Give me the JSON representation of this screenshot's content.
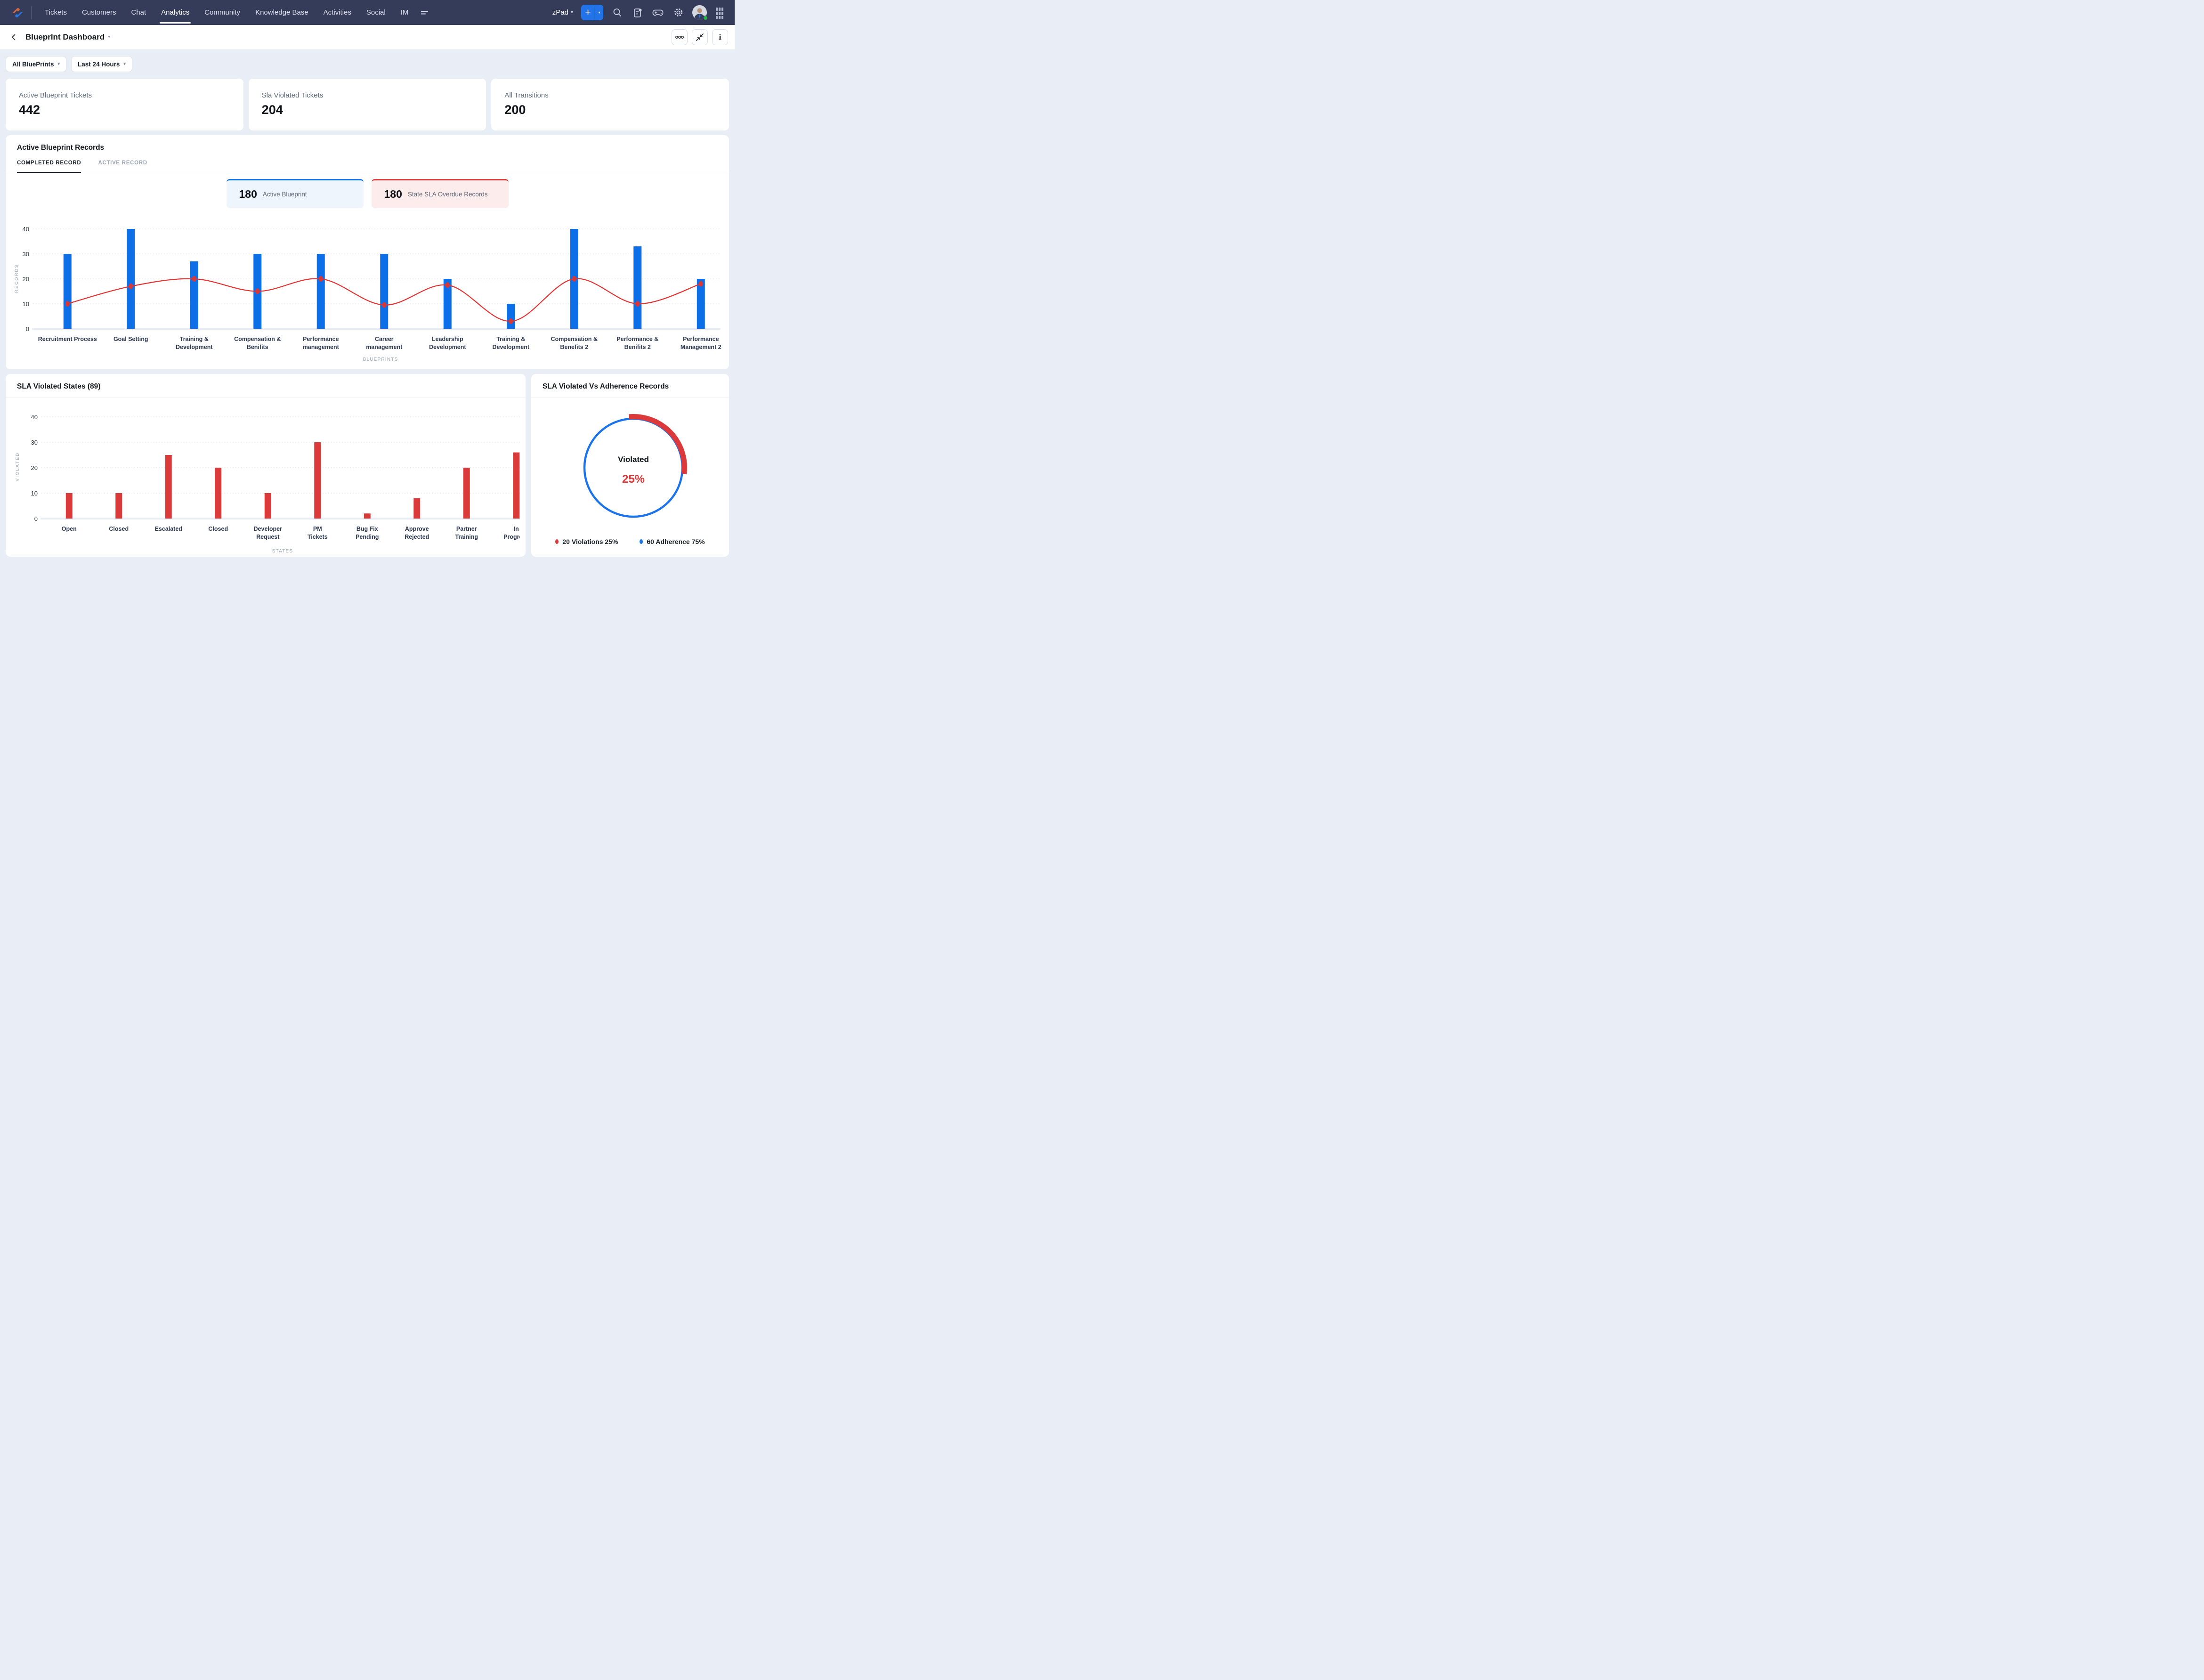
{
  "nav": {
    "items": [
      {
        "label": "Tickets",
        "active": false
      },
      {
        "label": "Customers",
        "active": false
      },
      {
        "label": "Chat",
        "active": false
      },
      {
        "label": "Analytics",
        "active": true
      },
      {
        "label": "Community",
        "active": false
      },
      {
        "label": "Knowledge Base",
        "active": false
      },
      {
        "label": "Activities",
        "active": false
      },
      {
        "label": "Social",
        "active": false
      },
      {
        "label": "IM",
        "active": false
      }
    ],
    "department_label": "zPad",
    "add_label": "+"
  },
  "header": {
    "title": "Blueprint Dashboard"
  },
  "filters": [
    {
      "label": "All BluePrints"
    },
    {
      "label": "Last 24 Hours"
    }
  ],
  "stats": [
    {
      "label": "Active Blueprint Tickets",
      "value": "442"
    },
    {
      "label": "Sla Violated Tickets",
      "value": "204"
    },
    {
      "label": "All Transitions",
      "value": "200"
    }
  ],
  "records_panel": {
    "title": "Active Blueprint Records",
    "tabs": [
      {
        "label": "COMPLETED RECORD",
        "active": true
      },
      {
        "label": "ACTIVE RECORD",
        "active": false
      }
    ],
    "badges": [
      {
        "value": "180",
        "label": "Active Blueprint",
        "theme": "blue"
      },
      {
        "value": "180",
        "label": "State SLA Overdue Records",
        "theme": "red"
      }
    ]
  },
  "violated_panel": {
    "title": "SLA Violated States (89)"
  },
  "donut_panel": {
    "title": "SLA Violated Vs Adherence Records"
  },
  "colors": {
    "bar_blue": "#0d6fe8",
    "bar_red": "#db3a3a",
    "line_red": "#e03434",
    "donut_blue": "#1a73e8",
    "donut_red": "#dc3a3a",
    "grid": "#dfe4ee",
    "baseline": "#e8ecf4",
    "tick_text": "#2a2f36",
    "cat_text": "#2c3850",
    "axis_title": "#9aa6b4"
  },
  "chart_data": [
    {
      "id": "blueprint-records",
      "type": "bar",
      "title": "Active Blueprint Records",
      "xlabel": "BLUEPRINTS",
      "ylabel": "RECORDS",
      "ylim": [
        0,
        40
      ],
      "yticks": [
        0,
        10,
        20,
        30,
        40
      ],
      "grid": true,
      "categories": [
        "Recruitment Process",
        "Goal Setting",
        "Training & Development",
        "Compensation & Benifits",
        "Performance management",
        "Career management",
        "Leadership Development",
        "Training & Development",
        "Compensation & Benefits 2",
        "Performance & Benifits 2",
        "Performance Management 2"
      ],
      "label_lines": [
        [
          "Recruitment Process"
        ],
        [
          "Goal Setting"
        ],
        [
          "Training &",
          "Development"
        ],
        [
          "Compensation &",
          "Benifits"
        ],
        [
          "Performance",
          "management"
        ],
        [
          "Career",
          "management"
        ],
        [
          "Leadership",
          "Development"
        ],
        [
          "Training &",
          "Development"
        ],
        [
          "Compensation &",
          "Benefits 2"
        ],
        [
          "Performance &",
          "Benifits 2"
        ],
        [
          "Performance",
          "Management 2"
        ]
      ],
      "series": [
        {
          "name": "Records",
          "type": "bar",
          "values": [
            30,
            40,
            27,
            30,
            30,
            30,
            20,
            10,
            40,
            33,
            20
          ]
        },
        {
          "name": "SLA",
          "type": "line",
          "values": [
            10,
            17,
            20,
            15,
            20,
            9.5,
            17.5,
            3,
            20,
            10,
            18
          ]
        }
      ]
    },
    {
      "id": "sla-violated-states",
      "type": "bar",
      "title": "SLA Violated States (89)",
      "xlabel": "STATES",
      "ylabel": "VIOLATED",
      "ylim": [
        0,
        40
      ],
      "yticks": [
        0,
        10,
        20,
        30,
        40
      ],
      "grid": true,
      "categories": [
        "Open",
        "Closed",
        "Escalated",
        "Closed",
        "Developer Request",
        "PM Tickets",
        "Bug Fix Pending",
        "Approve Rejected",
        "Partner Training",
        "In Progress"
      ],
      "label_lines": [
        [
          "Open"
        ],
        [
          "Closed"
        ],
        [
          "Escalated"
        ],
        [
          "Closed"
        ],
        [
          "Developer",
          "Request"
        ],
        [
          "PM",
          "Tickets"
        ],
        [
          "Bug Fix",
          "Pending"
        ],
        [
          "Approve",
          "Rejected"
        ],
        [
          "Partner",
          "Training"
        ],
        [
          "In",
          "Progress"
        ]
      ],
      "values": [
        10,
        10,
        25,
        20,
        10,
        30,
        2,
        8,
        20,
        26
      ]
    },
    {
      "id": "sla-violated-vs-adherence",
      "type": "pie",
      "title": "SLA Violated Vs Adherence Records",
      "center_label": "Violated",
      "center_value": "25%",
      "slices": [
        {
          "label": "Violations",
          "value": 20,
          "pct": "25%",
          "color": "#dc3a3a"
        },
        {
          "label": "Adherence",
          "value": 60,
          "pct": "75%",
          "color": "#1a73e8"
        }
      ],
      "legend": [
        {
          "text": "20 Violations 25%",
          "color": "#dc3a3a"
        },
        {
          "text": "60 Adherence 75%",
          "color": "#1a73e8"
        }
      ]
    }
  ]
}
